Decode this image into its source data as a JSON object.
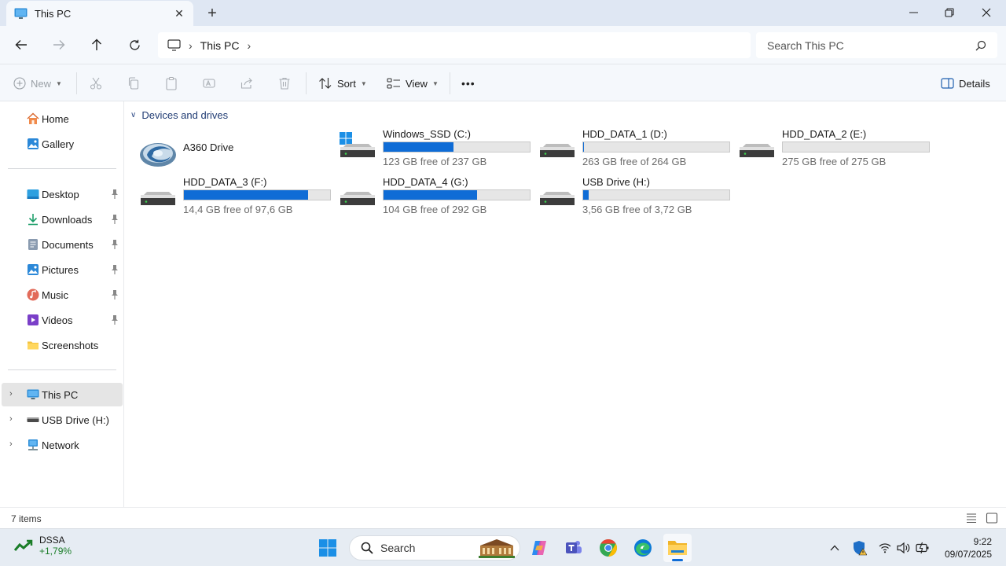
{
  "window": {
    "tab_title": "This PC",
    "new_tab_symbol": "+",
    "close_tab_symbol": "✕"
  },
  "address_bar": {
    "path": [
      "This PC"
    ],
    "search_placeholder": "Search This PC"
  },
  "command_bar": {
    "new_label": "New",
    "sort_label": "Sort",
    "view_label": "View",
    "more_symbol": "•••",
    "details_label": "Details"
  },
  "sidebar": {
    "quick": [
      {
        "label": "Home",
        "icon": "home-icon"
      },
      {
        "label": "Gallery",
        "icon": "gallery-icon"
      }
    ],
    "pinned": [
      {
        "label": "Desktop",
        "icon": "desktop-folder-icon",
        "pinned": true
      },
      {
        "label": "Downloads",
        "icon": "downloads-folder-icon",
        "pinned": true
      },
      {
        "label": "Documents",
        "icon": "documents-folder-icon",
        "pinned": true
      },
      {
        "label": "Pictures",
        "icon": "pictures-folder-icon",
        "pinned": true
      },
      {
        "label": "Music",
        "icon": "music-folder-icon",
        "pinned": true
      },
      {
        "label": "Videos",
        "icon": "videos-folder-icon",
        "pinned": true
      },
      {
        "label": "Screenshots",
        "icon": "folder-icon",
        "pinned": false
      }
    ],
    "tree": [
      {
        "label": "This PC",
        "icon": "computer-icon",
        "selected": true
      },
      {
        "label": "USB Drive (H:)",
        "icon": "usb-drive-icon",
        "selected": false
      },
      {
        "label": "Network",
        "icon": "network-icon",
        "selected": false
      }
    ]
  },
  "content": {
    "group_title": "Devices and drives",
    "drives": [
      {
        "name": "A360 Drive",
        "free": "",
        "used_fraction": null,
        "icon": "a360-drive-icon"
      },
      {
        "name": "Windows_SSD (C:)",
        "free": "123 GB free of 237 GB",
        "used_fraction": 0.48,
        "icon": "windows-drive-icon"
      },
      {
        "name": "HDD_DATA_1 (D:)",
        "free": "263 GB free of 264 GB",
        "used_fraction": 0.004,
        "icon": "hard-drive-icon"
      },
      {
        "name": "HDD_DATA_2 (E:)",
        "free": "275 GB free of 275 GB",
        "used_fraction": 0.0,
        "icon": "hard-drive-icon"
      },
      {
        "name": "HDD_DATA_3 (F:)",
        "free": "14,4 GB free of 97,6 GB",
        "used_fraction": 0.85,
        "icon": "hard-drive-icon"
      },
      {
        "name": "HDD_DATA_4 (G:)",
        "free": "104 GB free of 292 GB",
        "used_fraction": 0.64,
        "icon": "hard-drive-icon"
      },
      {
        "name": "USB Drive (H:)",
        "free": "3,56 GB free of 3,72 GB",
        "used_fraction": 0.04,
        "icon": "hard-drive-icon"
      }
    ]
  },
  "status": {
    "item_count": "7 items"
  },
  "taskbar": {
    "widget_name": "DSSA",
    "widget_value": "+1,79%",
    "search_label": "Search",
    "time": "9:22",
    "date": "09/07/2025"
  },
  "colors": {
    "accent": "#0f6cd6",
    "selected_bg": "#e5e5e5",
    "chrome_bg": "#f5f8fc",
    "titlebar_bg": "#dfe7f3"
  }
}
